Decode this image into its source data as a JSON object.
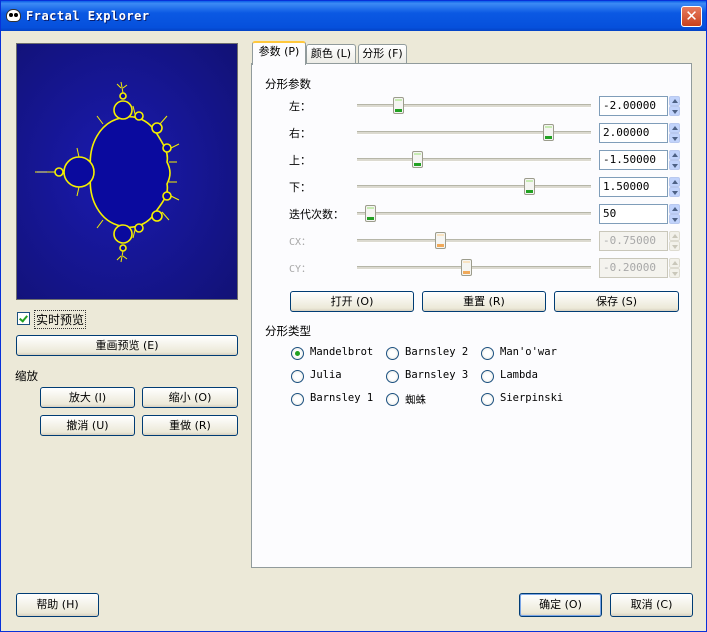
{
  "window": {
    "title": "Fractal Explorer",
    "close_symbol": "✕"
  },
  "preview": {
    "realtime_label": "实时预览",
    "realtime_checked": true,
    "redraw_label": "重画预览 (E)"
  },
  "zoom": {
    "title": "缩放",
    "zoom_in": "放大 (I)",
    "zoom_out": "缩小 (O)",
    "undo": "撤消 (U)",
    "redo": "重做 (R)"
  },
  "tabs": [
    {
      "label": "参数 (P)",
      "active": true
    },
    {
      "label": "颜色 (L)",
      "active": false
    },
    {
      "label": "分形 (F)",
      "active": false
    }
  ],
  "params": {
    "section_title": "分形参数",
    "rows": [
      {
        "label": "左：",
        "value": "-2.00000",
        "fraction": 0.18,
        "enabled": true
      },
      {
        "label": "右：",
        "value": "2.00000",
        "fraction": 0.82,
        "enabled": true
      },
      {
        "label": "上：",
        "value": "-1.50000",
        "fraction": 0.26,
        "enabled": true
      },
      {
        "label": "下：",
        "value": "1.50000",
        "fraction": 0.74,
        "enabled": true
      },
      {
        "label": "迭代次数：",
        "value": "50",
        "fraction": 0.06,
        "enabled": true
      },
      {
        "label": "CX：",
        "value": "-0.75000",
        "fraction": 0.36,
        "enabled": false
      },
      {
        "label": "CY：",
        "value": "-0.20000",
        "fraction": 0.47,
        "enabled": false
      }
    ],
    "open_label": "打开 (O)",
    "reset_label": "重置 (R)",
    "save_label": "保存 (S)"
  },
  "fractal_type": {
    "section_title": "分形类型",
    "options": [
      "Mandelbrot",
      "Barnsley 2",
      "Man'o'war",
      "Julia",
      "Barnsley 3",
      "Lambda",
      "Barnsley 1",
      "蜘蛛",
      "Sierpinski"
    ],
    "selected": "Mandelbrot"
  },
  "footer": {
    "help_label": "帮助 (H)",
    "ok_label": "确定 (O)",
    "cancel_label": "取消 (C)"
  },
  "colors": {
    "preview_background": "#14148c",
    "fractal_interior": "#0a0a9e",
    "fractal_edge": "#f5f000",
    "accent_tab": "#ffc83c",
    "titlebar": "#0650dc"
  }
}
